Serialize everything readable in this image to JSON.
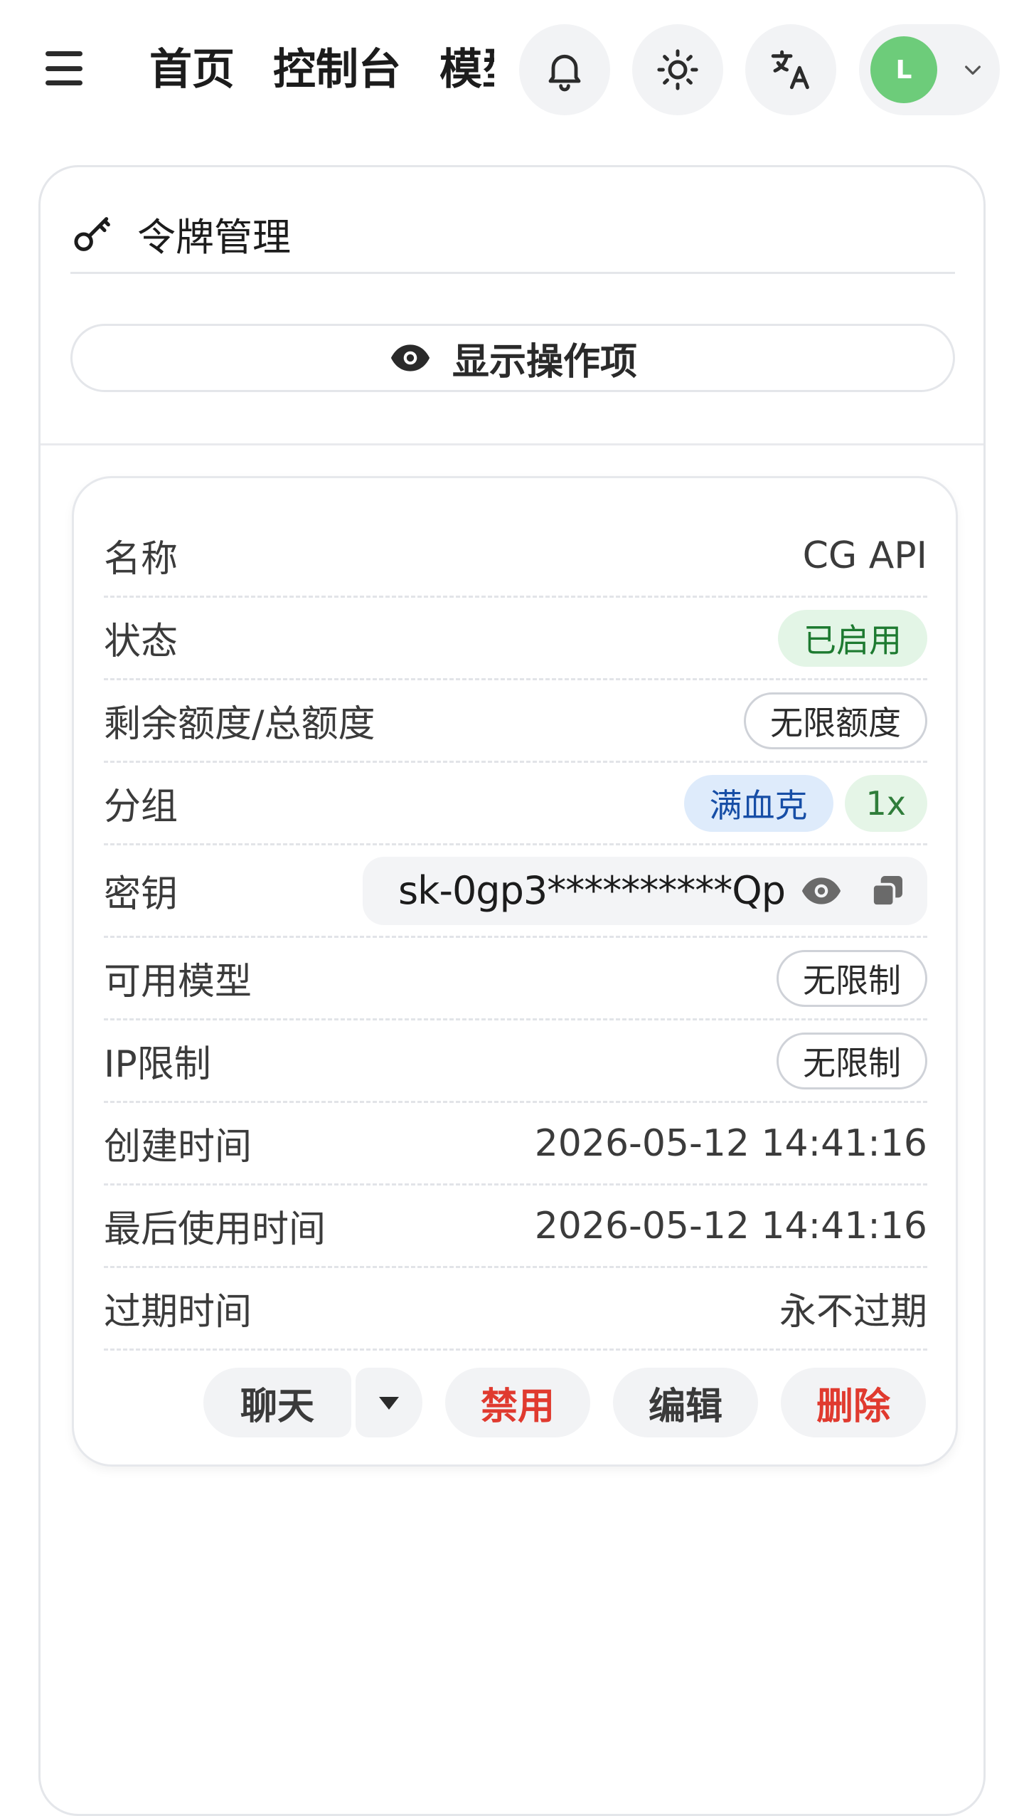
{
  "header": {
    "nav": [
      "首页",
      "控制台",
      "模型"
    ],
    "avatar_letter": "L",
    "icons": [
      "menu-icon",
      "bell-icon",
      "sun-icon",
      "translate-icon",
      "chevron-down-icon"
    ]
  },
  "panel": {
    "title": "令牌管理",
    "show_actions": "显示操作项"
  },
  "token": {
    "name_label": "名称",
    "name_value": "CG API",
    "status_label": "状态",
    "status_value": "已启用",
    "quota_label": "剩余额度/总额度",
    "quota_value": "无限额度",
    "group_label": "分组",
    "group_value": "满血克",
    "ratio_value": "1x",
    "key_label": "密钥",
    "key_value": "sk-0gp3**********Qp",
    "models_label": "可用模型",
    "models_value": "无限制",
    "ip_label": "IP限制",
    "ip_value": "无限制",
    "created_label": "创建时间",
    "created_value": "2026-05-12 14:41:16",
    "last_used_label": "最后使用时间",
    "last_used_value": "2026-05-12 14:41:16",
    "expire_label": "过期时间",
    "expire_value": "永不过期"
  },
  "actions": {
    "chat": "聊天",
    "disable": "禁用",
    "edit": "编辑",
    "delete": "删除"
  },
  "colors": {
    "status_green": "#1d7a30",
    "danger_red": "#e03a2f",
    "group_blue": "#174ea6",
    "avatar_green": "#6dcc7a"
  }
}
